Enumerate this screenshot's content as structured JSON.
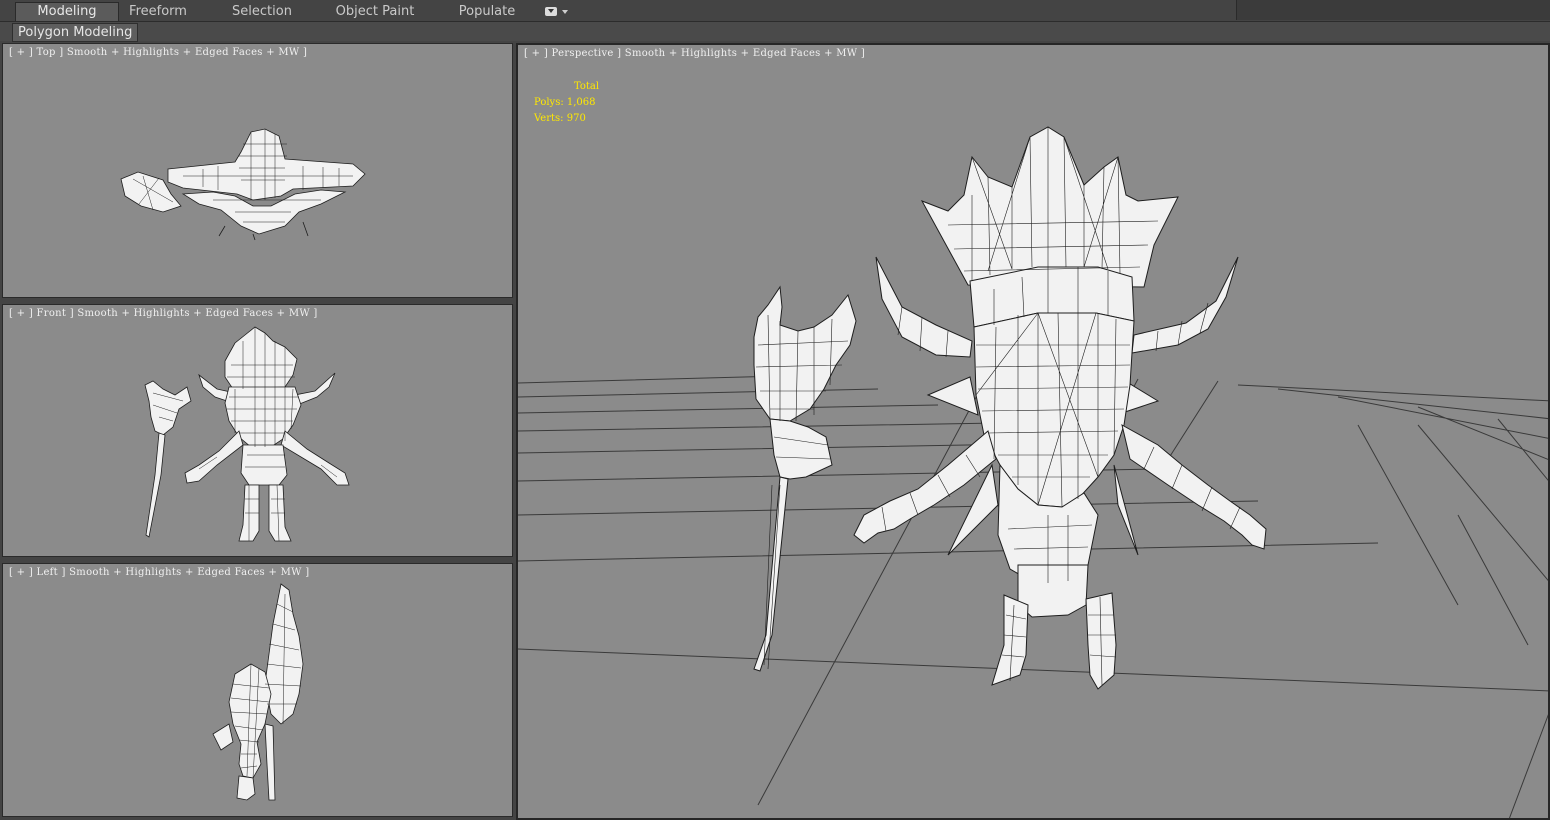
{
  "ribbon": {
    "tabs": [
      {
        "label": "Modeling",
        "active": true
      },
      {
        "label": "Freeform",
        "active": false
      },
      {
        "label": "Selection",
        "active": false
      },
      {
        "label": "Object Paint",
        "active": false
      },
      {
        "label": "Populate",
        "active": false
      }
    ],
    "sub_tab": "Polygon Modeling"
  },
  "viewports": {
    "top": {
      "label": "[ + ] Top ] Smooth + Highlights + Edged Faces + MW ]"
    },
    "front": {
      "label": "[ + ] Front ] Smooth + Highlights + Edged Faces + MW ]"
    },
    "left": {
      "label": "[ + ] Left ] Smooth + Highlights + Edged Faces + MW ]"
    },
    "perspective": {
      "label": "[ + ] Perspective ] Smooth + Highlights + Edged Faces + MW ]",
      "stats": {
        "header": "Total",
        "polys_label": "Polys:",
        "polys_value": "1,068",
        "verts_label": "Verts:",
        "verts_value": "970"
      }
    }
  },
  "colors": {
    "viewport_bg": "#8b8b8b",
    "ui_bg": "#444444",
    "stats_text": "#ffe800",
    "model_fill": "#f2f2f2",
    "wire": "#1e1e1e",
    "grid": "#3a3a3a"
  }
}
